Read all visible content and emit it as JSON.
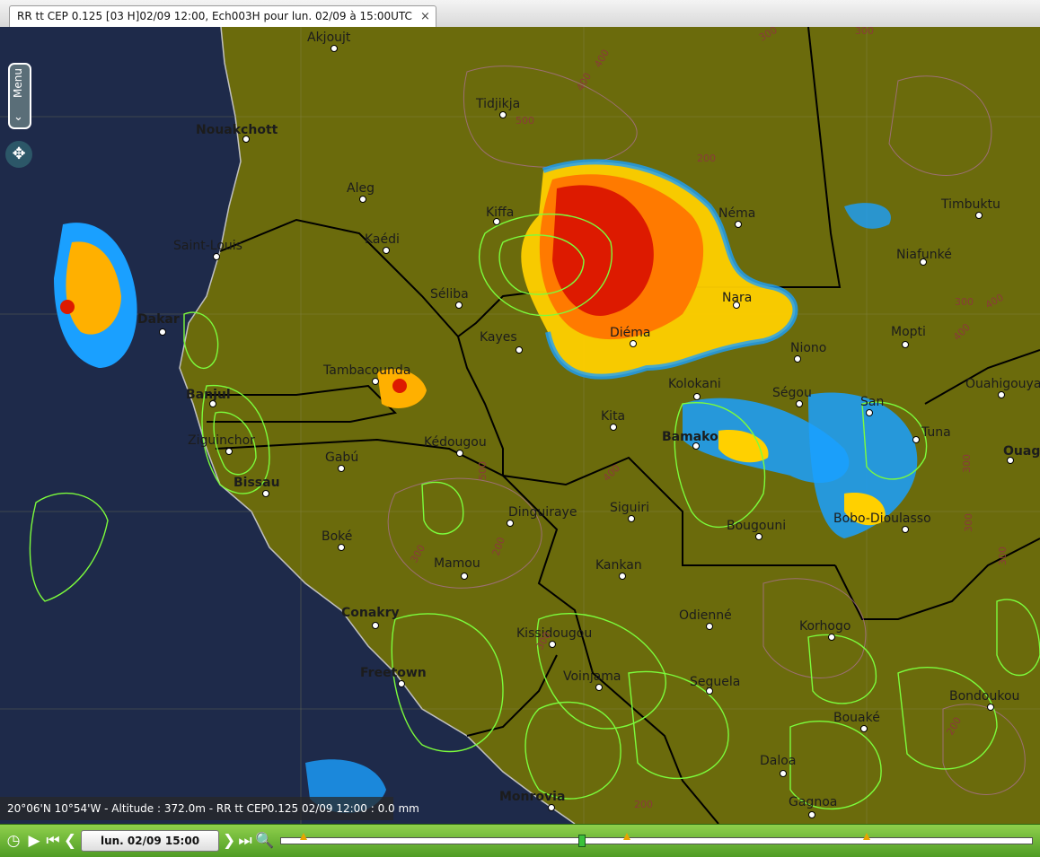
{
  "window": {
    "tab_title": "RR tt CEP 0.125 [03 H]02/09 12:00, Ech003H pour lun. 02/09 à 15:00UTC",
    "close_icon": "×"
  },
  "menu": {
    "label": "Menu"
  },
  "status": {
    "text": "20°06'N 10°54'W - Altitude : 372.0m - RR tt CEP0.125 02/09 12:00 : 0.0 mm"
  },
  "controls": {
    "date_label": "lun. 02/09 15:00"
  },
  "timeline": {
    "current_fraction": 0.4,
    "markers_fraction": [
      0.03,
      0.46,
      0.78
    ]
  },
  "map": {
    "cities": [
      {
        "name": "Akjoujt"
      },
      {
        "name": "Nouakchott",
        "bold": true
      },
      {
        "name": "Tidjikja"
      },
      {
        "name": "Aleg"
      },
      {
        "name": "Kiffa"
      },
      {
        "name": "Néma"
      },
      {
        "name": "Timbuktu"
      },
      {
        "name": "Saint-Louis"
      },
      {
        "name": "Kaédi"
      },
      {
        "name": "Dakar",
        "bold": true
      },
      {
        "name": "Séliba"
      },
      {
        "name": "Nara"
      },
      {
        "name": "Kayes"
      },
      {
        "name": "Diéma"
      },
      {
        "name": "Niafunké"
      },
      {
        "name": "Mopti"
      },
      {
        "name": "Niono"
      },
      {
        "name": "Tambacounda"
      },
      {
        "name": "Banjul",
        "bold": true
      },
      {
        "name": "Kolokani"
      },
      {
        "name": "Ségou"
      },
      {
        "name": "Ouahigouya"
      },
      {
        "name": "Kita"
      },
      {
        "name": "Bamako",
        "bold": true
      },
      {
        "name": "San"
      },
      {
        "name": "Ziguinchor"
      },
      {
        "name": "Kédougou"
      },
      {
        "name": "Tuna"
      },
      {
        "name": "Ouagadougou",
        "bold": true
      },
      {
        "name": "Gabú"
      },
      {
        "name": "Bissau",
        "bold": true
      },
      {
        "name": "Dinguiraye"
      },
      {
        "name": "Siguiri"
      },
      {
        "name": "Bobo-Dioulasso"
      },
      {
        "name": "Boké"
      },
      {
        "name": "Bougouni"
      },
      {
        "name": "Mamou"
      },
      {
        "name": "Kankan"
      },
      {
        "name": "Conakry",
        "bold": true
      },
      {
        "name": "Odienné"
      },
      {
        "name": "Korhogo"
      },
      {
        "name": "Kissidougou"
      },
      {
        "name": "Freetown",
        "bold": true
      },
      {
        "name": "Voinjama"
      },
      {
        "name": "Seguela"
      },
      {
        "name": "Bondoukou"
      },
      {
        "name": "Bouaké"
      },
      {
        "name": "Daloa"
      },
      {
        "name": "Gagnoa"
      },
      {
        "name": "Monrovia",
        "bold": true
      }
    ],
    "altitude_labels": [
      "400",
      "300",
      "400",
      "300",
      "500",
      "200",
      "300",
      "400",
      "400",
      "300",
      "300",
      "500",
      "400",
      "300",
      "300",
      "300",
      "200",
      "200",
      "200"
    ],
    "colors": {
      "ocean": "#1e2a4a",
      "land": "#6b6b0c",
      "rain_green": "#7cfc3c",
      "contour": "#b070a0"
    }
  }
}
